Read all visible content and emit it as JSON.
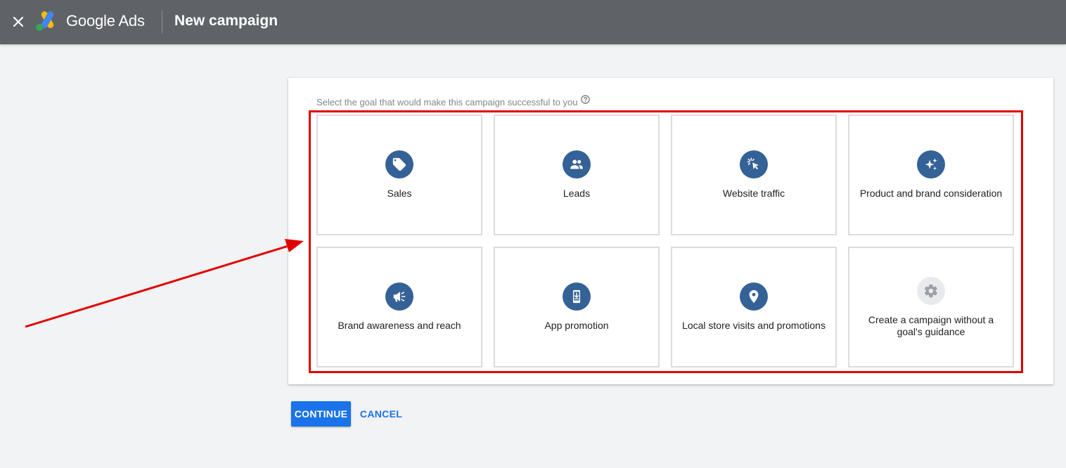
{
  "header": {
    "brand_name": "Google Ads",
    "page_title": "New campaign",
    "close_icon": "close-icon",
    "logo_icon": "google-ads-logo",
    "background_color": "#5f6368"
  },
  "goal_section": {
    "prompt": "Select the goal that would make this campaign successful to you",
    "help_icon": "help-circle-icon",
    "highlight_color": "#e10000",
    "goals": [
      {
        "label": "Sales",
        "icon": "tag-icon"
      },
      {
        "label": "Leads",
        "icon": "people-icon"
      },
      {
        "label": "Website traffic",
        "icon": "cursor-click-icon"
      },
      {
        "label": "Product and brand consideration",
        "icon": "sparkle-icon"
      },
      {
        "label": "Brand awareness and reach",
        "icon": "megaphone-icon"
      },
      {
        "label": "App promotion",
        "icon": "phone-download-icon"
      },
      {
        "label": "Local store visits and promotions",
        "icon": "location-pin-icon"
      },
      {
        "label": "Create a campaign without a goal's guidance",
        "icon": "gear-icon"
      }
    ],
    "icon_color": "#346297"
  },
  "actions": {
    "continue_label": "CONTINUE",
    "cancel_label": "CANCEL",
    "primary_color": "#1a73e8"
  }
}
